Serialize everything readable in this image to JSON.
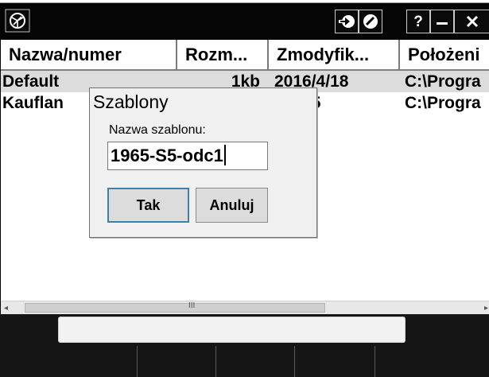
{
  "window": {
    "app_icon": "app-logo-icon",
    "toolbar_icons": [
      "enter-arrow-icon",
      "no-entry-icon"
    ],
    "help_label": "?",
    "minimize_icon": "minimize-icon",
    "close_icon": "close-icon"
  },
  "list": {
    "columns": [
      "Nazwa/numer",
      "Rozm...",
      "Zmodyfik...",
      "Położeni"
    ],
    "rows": [
      {
        "name": "Default",
        "size": "1kb",
        "modified": "2016/4/18",
        "location": "C:\\Progra"
      },
      {
        "name": "Kauflan",
        "size": "",
        "modified": "5/7/25",
        "location": "C:\\Progra"
      }
    ],
    "scrollbar_grip": "III"
  },
  "dialog": {
    "title": "Szablony",
    "field_label": "Nazwa szablonu:",
    "field_value": "1965-S5-odc1",
    "ok_label": "Tak",
    "cancel_label": "Anuluj"
  },
  "colors": {
    "titlebar": "#050505",
    "selected_row": "#dcdcdc",
    "dialog_bg": "#f0f0f0",
    "focus_border": "#3c7fb1",
    "bottom_bar": "#151515"
  }
}
